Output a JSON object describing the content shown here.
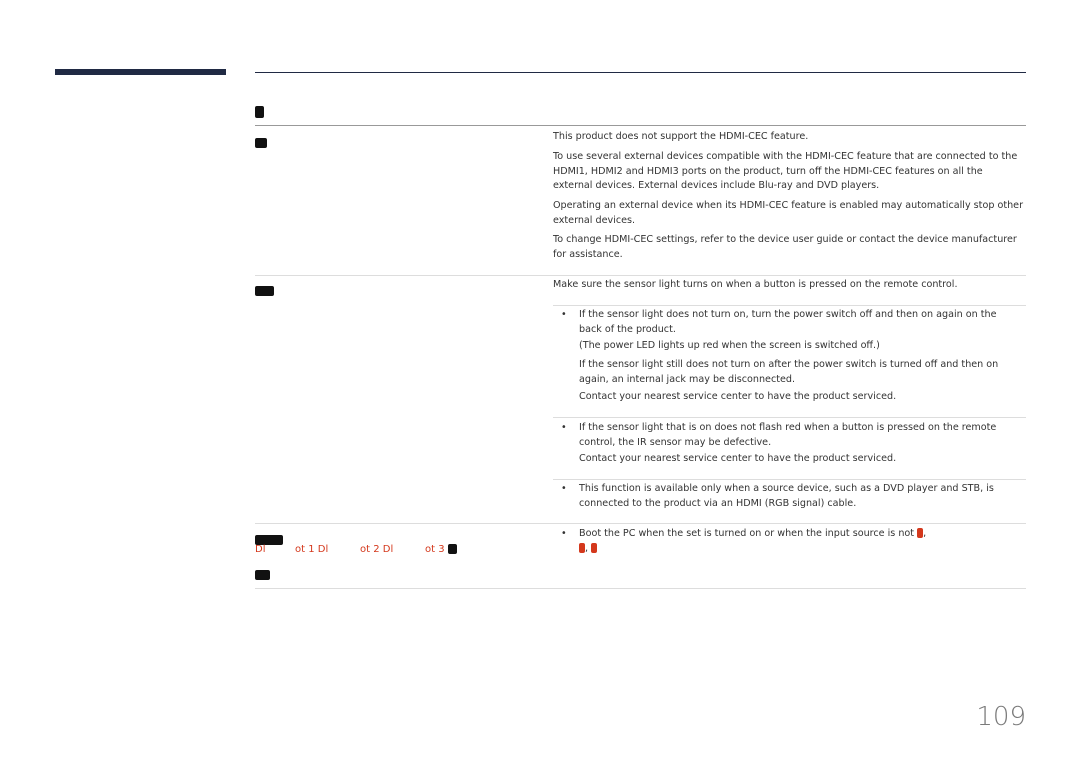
{
  "rows": {
    "hdmi_cec": [
      "This product does not support the HDMI-CEC feature.",
      "To use several external devices compatible with the HDMI-CEC feature that are connected to the HDMI1, HDMI2 and HDMI3 ports on the product, turn off the HDMI-CEC features on all the external devices. External devices include Blu-ray and DVD players.",
      "Operating an external device when its HDMI-CEC feature is enabled may automatically stop other external devices.",
      "To change HDMI-CEC settings, refer to the device user guide or contact the device manufacturer for assistance."
    ],
    "remote": {
      "intro": "Make sure the sensor light turns on when a button is pressed on the remote control.",
      "b1": [
        "If the sensor light does not turn on, turn the power switch off and then on again on the back of the product.",
        "(The power LED lights up red when the screen is switched off.)",
        "If the sensor light still does not turn on after the power switch is turned off and then on again, an internal jack may be disconnected.",
        "Contact your nearest service center to have the product serviced."
      ],
      "b2": [
        "If the sensor light that is on does not flash red when a button is pressed on the remote control, the IR sensor may be defective.",
        "Contact your nearest service center to have the product serviced."
      ],
      "b3": "This function is available only when a source device, such as a DVD player and STB, is connected to the product via an HDMI (RGB signal) cable."
    },
    "boot": {
      "red_labels": [
        "Dl",
        "ot 1 Dl",
        "ot 2 Dl",
        "ot 3"
      ],
      "text": "Boot the PC when the set is turned on or when the input source is not"
    }
  },
  "bullet": "•",
  "page_number": "109",
  "colors": {
    "accent": "#202a44",
    "highlight": "#d4381c"
  }
}
